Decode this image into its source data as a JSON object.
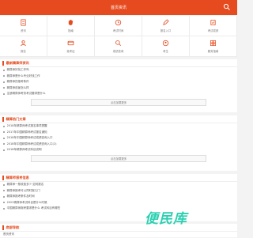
{
  "header": {
    "title": "首页资讯"
  },
  "menu": [
    {
      "label": "资讯",
      "icon": "page-icon"
    },
    {
      "label": "指南",
      "icon": "map-icon"
    },
    {
      "label": "考试时间",
      "icon": "clock-icon"
    },
    {
      "label": "报名入口",
      "icon": "pen-icon"
    },
    {
      "label": "考试成绩",
      "icon": "doc-icon"
    },
    {
      "label": "报名",
      "icon": "user-icon"
    },
    {
      "label": "准考证",
      "icon": "card-icon"
    },
    {
      "label": "成绩查询",
      "icon": "search-icon"
    },
    {
      "label": "考生",
      "icon": "person-icon"
    },
    {
      "label": "服务指南",
      "icon": "grid-icon"
    }
  ],
  "sections": [
    {
      "title": "最新精算师资讯",
      "items": [
        "精算师好找工作吗",
        "精算师是什么专业好找工作",
        "精算师的报考条件",
        "精算师前景怎么样",
        "注册精算师考务考试要求是什么"
      ],
      "more": "点击加载更多"
    },
    {
      "title": "精算热门文章",
      "items": [
        "2018年精算师考试报名事项提醒",
        "2017年中国精算师考试报名通知",
        "2018年中国精算师考试成绩查询入口",
        "2018年中国精算师考试成绩查询入口(2)",
        "2018年精算师考试科目说明"
      ],
      "more": "点击加载更多"
    },
    {
      "title": "精算师报考信息",
      "items": [
        "精算师一般收费多少 如何报名",
        "精算师报考可以同时报几门",
        "精算师报考条件及时间",
        "2022精算师考试科目是什么时候",
        "中国精算师报考要求是什么 考试科目有哪些"
      ],
      "more": ""
    },
    {
      "title": "底部导航",
      "items": [
        "首页资讯"
      ],
      "more": ""
    }
  ],
  "watermark": "便民库",
  "colors": {
    "accent": "#e54b1f",
    "watermark": "#2bd0b1"
  }
}
